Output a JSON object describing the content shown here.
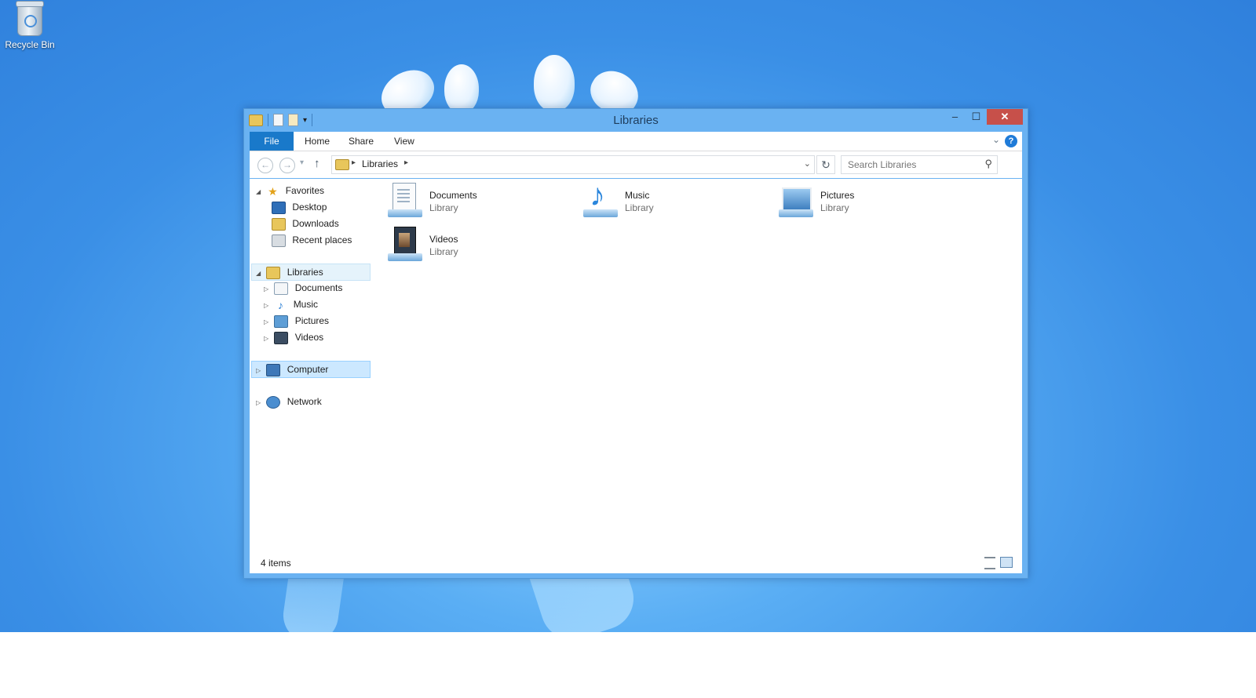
{
  "desktop": {
    "recycle_bin_label": "Recycle Bin"
  },
  "window": {
    "title": "Libraries",
    "controls": {
      "minimize": "‒",
      "maximize": "☐",
      "close": "✕"
    }
  },
  "ribbon": {
    "tabs": [
      "File",
      "Home",
      "Share",
      "View"
    ],
    "help": "?"
  },
  "navigation": {
    "back": "←",
    "forward": "→",
    "up": "↑",
    "breadcrumb": "Libraries",
    "search_placeholder": "Search Libraries"
  },
  "nav_pane": {
    "favorites": {
      "label": "Favorites",
      "items": [
        "Desktop",
        "Downloads",
        "Recent places"
      ]
    },
    "libraries": {
      "label": "Libraries",
      "items": [
        "Documents",
        "Music",
        "Pictures",
        "Videos"
      ]
    },
    "computer": "Computer",
    "network": "Network"
  },
  "libraries": [
    {
      "name": "Documents",
      "type": "Library",
      "icon": "documents-library-icon"
    },
    {
      "name": "Music",
      "type": "Library",
      "icon": "music-library-icon"
    },
    {
      "name": "Pictures",
      "type": "Library",
      "icon": "pictures-library-icon"
    },
    {
      "name": "Videos",
      "type": "Library",
      "icon": "videos-library-icon"
    }
  ],
  "status": {
    "item_count": "4 items"
  },
  "colors": {
    "file_tab": "#1979ca",
    "title_bar": "#6ab2f2",
    "close_button": "#c7504a",
    "selection": "#cce8ff"
  }
}
